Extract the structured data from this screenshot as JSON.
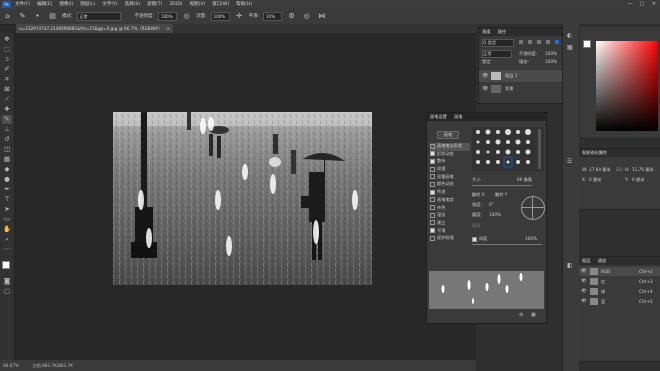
{
  "menu": {
    "logo": "Ps",
    "items": [
      "文件(F)",
      "编辑(E)",
      "图像(I)",
      "图层(L)",
      "文字(Y)",
      "选择(S)",
      "滤镜(T)",
      "3D(D)",
      "视图(V)",
      "窗口(W)",
      "帮助(H)"
    ],
    "win_min": "—",
    "win_max": "□",
    "win_close": "✕"
  },
  "options": {
    "mode_label": "模式:",
    "mode_value": "正常",
    "opacity_label": "不透明度:",
    "opacity_value": "100%",
    "flow_label": "流量:",
    "flow_value": "100%",
    "smooth_label": "平滑:",
    "smooth_value": "10%"
  },
  "document": {
    "tab_title": "u=2329747d7,2146690681&fm=15&gp=0.jpg @ 66.7%（RGB/8#）",
    "tab_close": "×",
    "status_zoom": "66.67%",
    "status_doc": "文档:883.7K/883.7K"
  },
  "channels_panel": {
    "tabs": [
      "通道",
      "路径"
    ],
    "search_placeholder": "Q 类型",
    "blend_mode": "正常",
    "opacity_label": "不透明度:",
    "opacity_value": "100%",
    "lock_label": "锁定:",
    "fill_label": "填充:",
    "fill_value": "100%",
    "layers": [
      {
        "name": "图层 1"
      },
      {
        "name": "背景"
      }
    ]
  },
  "brush_panel": {
    "tabs": [
      "画笔设置",
      "画笔"
    ],
    "preset_button": "画笔",
    "options": [
      {
        "label": "画笔笔尖形状",
        "checked": false,
        "active": true
      },
      {
        "label": "形状动态",
        "checked": true
      },
      {
        "label": "散布",
        "checked": true
      },
      {
        "label": "纹理",
        "checked": false
      },
      {
        "label": "双重画笔",
        "checked": false
      },
      {
        "label": "颜色动态",
        "checked": false
      },
      {
        "label": "传递",
        "checked": true
      },
      {
        "label": "画笔笔势",
        "checked": false
      },
      {
        "label": "杂色",
        "checked": false
      },
      {
        "label": "湿边",
        "checked": false
      },
      {
        "label": "建立",
        "checked": false
      },
      {
        "label": "平滑",
        "checked": true
      },
      {
        "label": "保护纹理",
        "checked": false
      }
    ],
    "size_label": "大小",
    "size_value": "60 像素",
    "flip_x": "翻转 X",
    "flip_y": "翻转 Y",
    "angle_label": "角度:",
    "angle_value": "0°",
    "roundness_label": "圆度:",
    "roundness_value": "100%",
    "hardness_label": "硬度",
    "spacing_label": "间距",
    "spacing_value": "100%"
  },
  "properties_panel": {
    "title": "智能锐化属性",
    "width_label": "W:",
    "width_value": "17.64 厘米",
    "link": "GO",
    "height_label": "H:",
    "height_value": "11.76 厘米",
    "x_label": "X:",
    "x_value": "0 厘米",
    "y_label": "Y:",
    "y_value": "0 厘米"
  },
  "layers_panel": {
    "tabs": [
      "图层",
      "通道"
    ],
    "rows": [
      {
        "name": "RGB",
        "shortcut": "Ctrl+2"
      },
      {
        "name": "红",
        "shortcut": "Ctrl+3"
      },
      {
        "name": "绿",
        "shortcut": "Ctrl+4"
      },
      {
        "name": "蓝",
        "shortcut": "Ctrl+5"
      }
    ]
  },
  "colors": {
    "accent": "#1473e6",
    "foreground": "#ffffff",
    "background": "#000000",
    "picker_hue": "#ff0000"
  }
}
